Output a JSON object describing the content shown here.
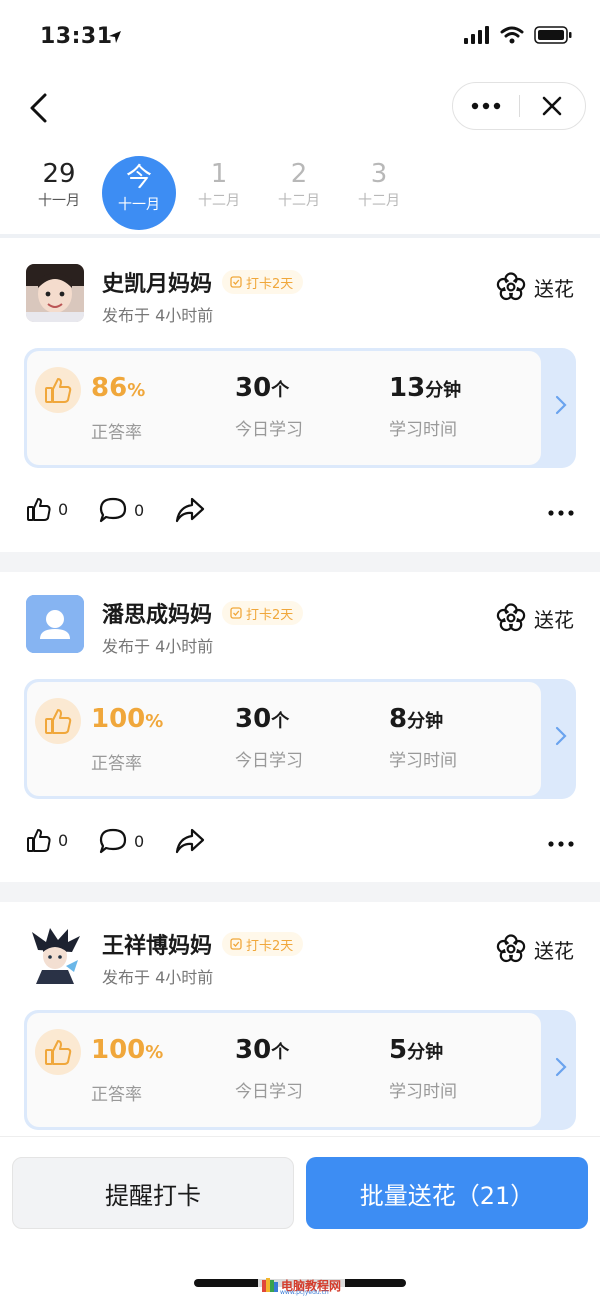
{
  "status_bar": {
    "time": "13:31"
  },
  "nav": {
    "more_icon": "more-dots-icon",
    "close_icon": "close-icon",
    "back_icon": "back-chevron-icon"
  },
  "dates": [
    {
      "num": "29",
      "month": "十一月",
      "state": "normal"
    },
    {
      "num": "今",
      "month": "十一月",
      "state": "active"
    },
    {
      "num": "1",
      "month": "十二月",
      "state": "faded"
    },
    {
      "num": "2",
      "month": "十二月",
      "state": "faded"
    },
    {
      "num": "3",
      "month": "十二月",
      "state": "faded"
    }
  ],
  "posts": [
    {
      "name": "史凯月妈妈",
      "badge": "打卡2天",
      "time": "发布于 4小时前",
      "flower": "送花",
      "accuracy": "86",
      "accuracy_unit": "%",
      "accuracy_label": "正答率",
      "today_count": "30",
      "today_unit": "个",
      "today_label": "今日学习",
      "duration": "13",
      "duration_unit": "分钟",
      "duration_label": "学习时间",
      "likes": "0",
      "comments": "0"
    },
    {
      "name": "潘思成妈妈",
      "badge": "打卡2天",
      "time": "发布于 4小时前",
      "flower": "送花",
      "accuracy": "100",
      "accuracy_unit": "%",
      "accuracy_label": "正答率",
      "today_count": "30",
      "today_unit": "个",
      "today_label": "今日学习",
      "duration": "8",
      "duration_unit": "分钟",
      "duration_label": "学习时间",
      "likes": "0",
      "comments": "0"
    },
    {
      "name": "王祥博妈妈",
      "badge": "打卡2天",
      "time": "发布于 4小时前",
      "flower": "送花",
      "accuracy": "100",
      "accuracy_unit": "%",
      "accuracy_label": "正答率",
      "today_count": "30",
      "today_unit": "个",
      "today_label": "今日学习",
      "duration": "5",
      "duration_unit": "分钟",
      "duration_label": "学习时间",
      "likes": "0",
      "comments": "0"
    }
  ],
  "bottom": {
    "remind_label": "提醒打卡",
    "send_flowers_label": "批量送花（21）"
  },
  "watermark": {
    "text": "电脑教程网",
    "url": "www.pcjyedu.cn"
  },
  "colors": {
    "primary": "#3d8df3",
    "accent_orange": "#f0a73b",
    "badge_bg": "#fff8ea"
  }
}
